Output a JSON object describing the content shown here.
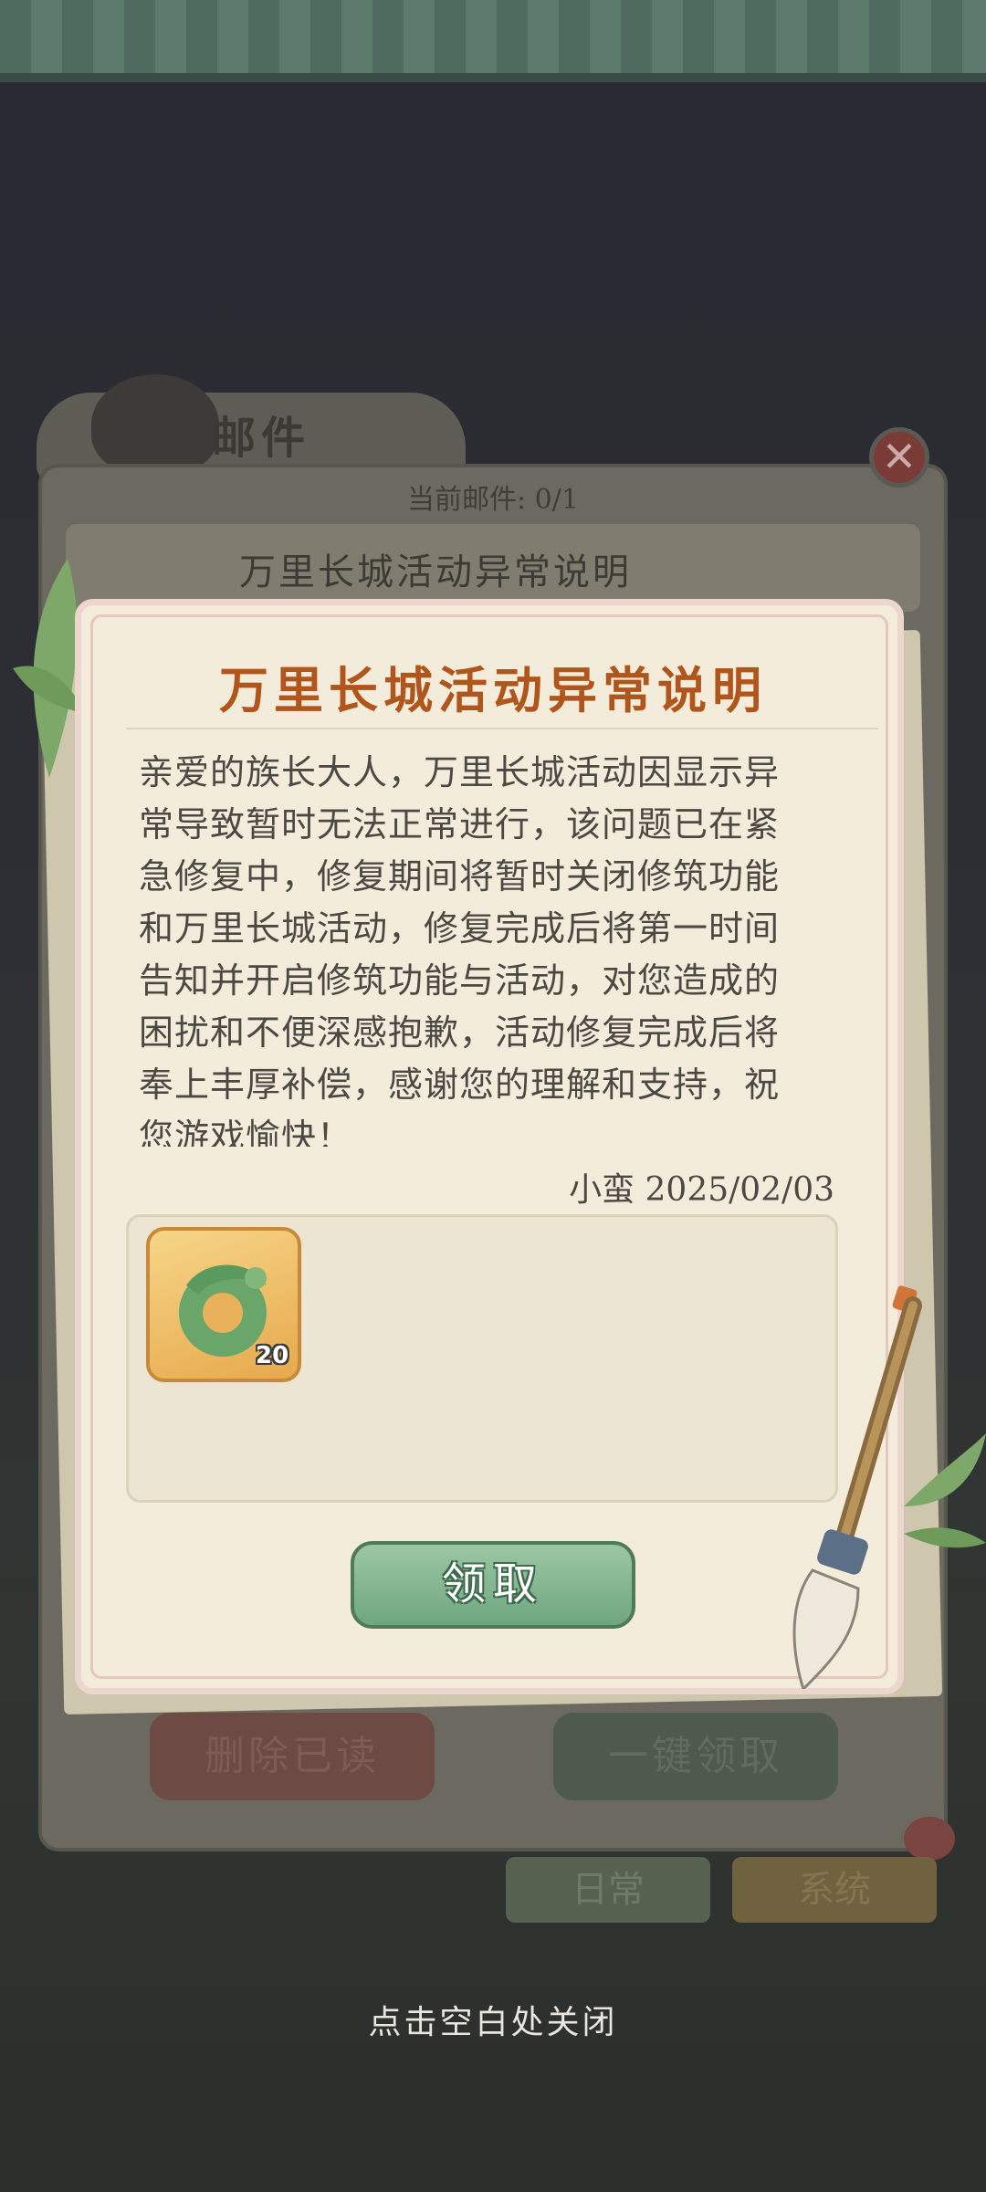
{
  "background": {
    "mail_window_title": "邮件",
    "mail_count": "当前邮件: 0/1",
    "mail_list": [
      {
        "title": "万里长城活动异常说明"
      }
    ],
    "delete_read_label": "删除已读",
    "claim_all_label": "一键领取",
    "tabs": [
      {
        "label": "日常"
      },
      {
        "label": "系统"
      }
    ],
    "close_icon_glyph": "✕"
  },
  "letter": {
    "title": "万里长城活动异常说明",
    "body": "亲爱的族长大人，万里长城活动因显示异常导致暂时无法正常进行，该问题已在紧急修复中，修复期间将暂时关闭修筑功能和万里长城活动，修复完成后将第一时间告知并开启修筑功能与活动，对您造成的困扰和不便深感抱歉，活动修复完成后将奉上丰厚补偿，感谢您的理解和支持，祝您游戏愉快！",
    "signature": "小蛮 2025/02/03",
    "rewards": [
      {
        "icon": "jade-dragon-icon",
        "count": "20"
      }
    ],
    "claim_label": "领取"
  },
  "close_hint": "点击空白处关闭",
  "colors": {
    "title": "#b0561c",
    "paper": "#f4ecdb",
    "claim_button": "#6fa680"
  }
}
